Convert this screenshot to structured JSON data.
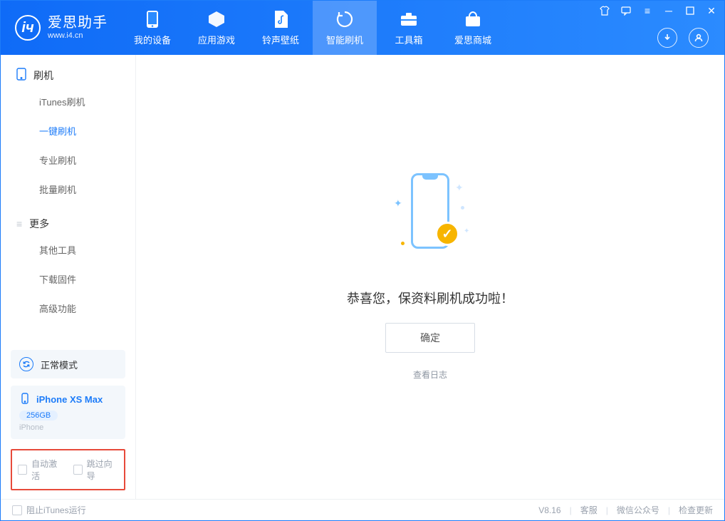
{
  "app": {
    "title": "爱思助手",
    "subtitle": "www.i4.cn"
  },
  "nav": {
    "tabs": [
      {
        "label": "我的设备"
      },
      {
        "label": "应用游戏"
      },
      {
        "label": "铃声壁纸"
      },
      {
        "label": "智能刷机"
      },
      {
        "label": "工具箱"
      },
      {
        "label": "爱思商城"
      }
    ],
    "active_index": 3
  },
  "sidebar": {
    "group1_title": "刷机",
    "group1_items": [
      {
        "label": "iTunes刷机"
      },
      {
        "label": "一键刷机"
      },
      {
        "label": "专业刷机"
      },
      {
        "label": "批量刷机"
      }
    ],
    "group1_active_index": 1,
    "group2_title": "更多",
    "group2_items": [
      {
        "label": "其他工具"
      },
      {
        "label": "下载固件"
      },
      {
        "label": "高级功能"
      }
    ],
    "mode_label": "正常模式",
    "device": {
      "name": "iPhone XS Max",
      "capacity": "256GB",
      "type": "iPhone"
    },
    "options": {
      "auto_activate": "自动激活",
      "skip_guide": "跳过向导"
    }
  },
  "main": {
    "success_text": "恭喜您，保资料刷机成功啦！",
    "ok_label": "确定",
    "view_log": "查看日志"
  },
  "footer": {
    "block_itunes": "阻止iTunes运行",
    "version": "V8.16",
    "links": {
      "service": "客服",
      "wechat": "微信公众号",
      "update": "检查更新"
    }
  }
}
